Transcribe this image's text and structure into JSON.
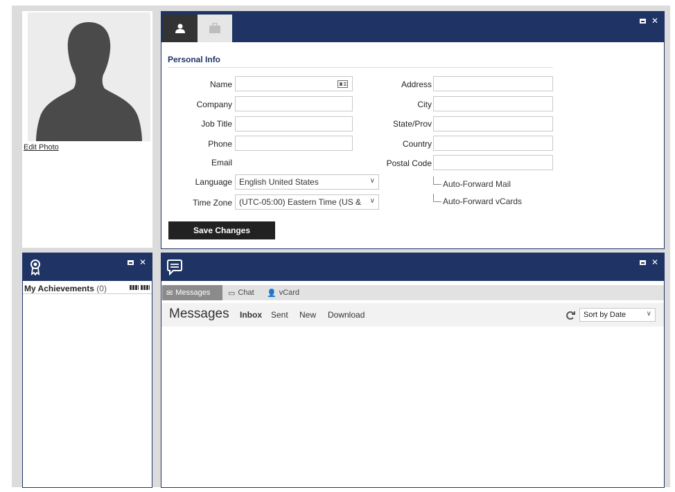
{
  "photo": {
    "edit_label": "Edit Photo"
  },
  "profile": {
    "section_title": "Personal Info",
    "fields_left": [
      {
        "label": "Name",
        "value": ""
      },
      {
        "label": "Company",
        "value": ""
      },
      {
        "label": "Job Title",
        "value": ""
      },
      {
        "label": "Phone",
        "value": ""
      },
      {
        "label": "Email",
        "value": ""
      }
    ],
    "fields_right": [
      {
        "label": "Address",
        "value": ""
      },
      {
        "label": "City",
        "value": ""
      },
      {
        "label": "State/Prov",
        "value": ""
      },
      {
        "label": "Country",
        "value": ""
      },
      {
        "label": "Postal Code",
        "value": ""
      }
    ],
    "language": {
      "label": "Language",
      "value": "English United States"
    },
    "timezone": {
      "label": "Time Zone",
      "value": "(UTC-05:00) Eastern Time (US &"
    },
    "checkboxes": [
      {
        "label": "Auto-Forward Mail",
        "checked": false
      },
      {
        "label": "Auto-Forward vCards",
        "checked": false
      }
    ],
    "save_label": "Save Changes"
  },
  "achievements": {
    "title": "My Achievements",
    "count": "(0)"
  },
  "messages": {
    "tabs": [
      {
        "label": "Messages",
        "icon": "envelope-icon",
        "active": true
      },
      {
        "label": "Chat",
        "icon": "chat-icon",
        "active": false
      },
      {
        "label": "vCard",
        "icon": "vcard-icon",
        "active": false
      }
    ],
    "heading": "Messages",
    "links": [
      "Inbox",
      "Sent",
      "New",
      "Download"
    ],
    "sort": "Sort by Date"
  },
  "colors": {
    "titlebar": "#1f3464",
    "button": "#222222",
    "active_tab": "#8b8b8b"
  }
}
